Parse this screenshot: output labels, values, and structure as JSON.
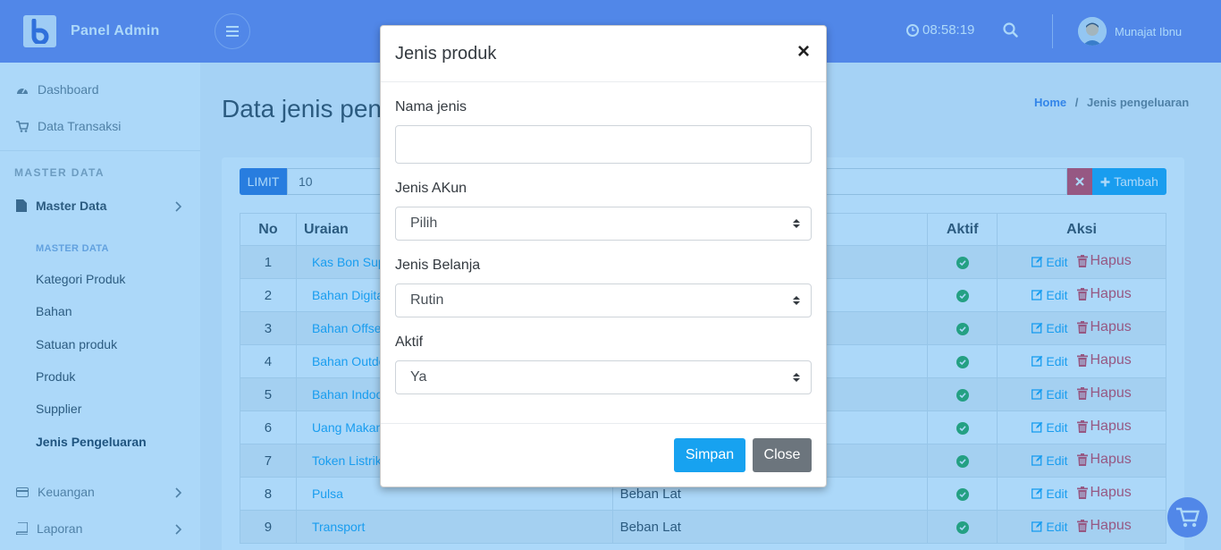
{
  "header": {
    "brand": "Panel Admin",
    "clock": "08:58:19",
    "user_name": "Munajat Ibnu"
  },
  "sidebar": {
    "dashboard": "Dashboard",
    "transaksi": "Data Transaksi",
    "section_master": "MASTER DATA",
    "master_data": "Master Data",
    "sub_heading": "MASTER DATA",
    "sub_items": [
      "Kategori Produk",
      "Bahan",
      "Satuan produk",
      "Produk",
      "Supplier",
      "Jenis Pengeluaran"
    ],
    "keuangan": "Keuangan",
    "laporan": "Laporan"
  },
  "page": {
    "title": "Data jenis pengeluaran",
    "breadcrumb_home": "Home",
    "breadcrumb_sep": "/",
    "breadcrumb_current": "Jenis pengeluaran"
  },
  "toolbar": {
    "limit_label": "LIMIT",
    "limit_value": "10",
    "add_label": "Tambah"
  },
  "table": {
    "headers": {
      "no": "No",
      "uraian": "Uraian",
      "aktif": "Aktif",
      "aksi": "Aksi"
    },
    "edit_label": "Edit",
    "delete_label": "Hapus",
    "rows": [
      {
        "no": "1",
        "uraian": "Kas Bon Sup",
        "jenis": ""
      },
      {
        "no": "2",
        "uraian": "Bahan Digita",
        "jenis": ""
      },
      {
        "no": "3",
        "uraian": "Bahan Offse",
        "jenis": ""
      },
      {
        "no": "4",
        "uraian": "Bahan Outdo",
        "jenis": ""
      },
      {
        "no": "5",
        "uraian": "Bahan Indoo",
        "jenis": ""
      },
      {
        "no": "6",
        "uraian": "Uang Makan",
        "jenis": ""
      },
      {
        "no": "7",
        "uraian": "Token Listrik",
        "jenis": ""
      },
      {
        "no": "8",
        "uraian": "Pulsa",
        "jenis": "Beban Lat"
      },
      {
        "no": "9",
        "uraian": "Transport",
        "jenis": "Beban Lat"
      }
    ]
  },
  "modal": {
    "title": "Jenis produk",
    "close_symbol": "×",
    "nama_label": "Nama jenis",
    "nama_value": "",
    "akun_label": "Jenis AKun",
    "akun_value": "Pilih",
    "belanja_label": "Jenis Belanja",
    "belanja_value": "Rutin",
    "aktif_label": "Aktif",
    "aktif_value": "Ya",
    "save_label": "Simpan",
    "close_label": "Close"
  },
  "colors": {
    "navbar": "#6f7fe5",
    "primary": "#17a2f0",
    "danger": "#dc3545",
    "success": "#28a745",
    "overlay": "rgba(30,150,240,0.37)"
  },
  "icons": {
    "logo": "brand-logo-icon",
    "menu": "hamburger-icon",
    "clock": "clock-icon",
    "search": "search-icon",
    "dashboard": "dashboard-icon",
    "cart": "cart-icon",
    "file": "file-icon",
    "card": "credit-card-icon",
    "book": "book-icon",
    "check": "check-circle-icon",
    "edit": "edit-icon",
    "trash": "trash-icon"
  }
}
